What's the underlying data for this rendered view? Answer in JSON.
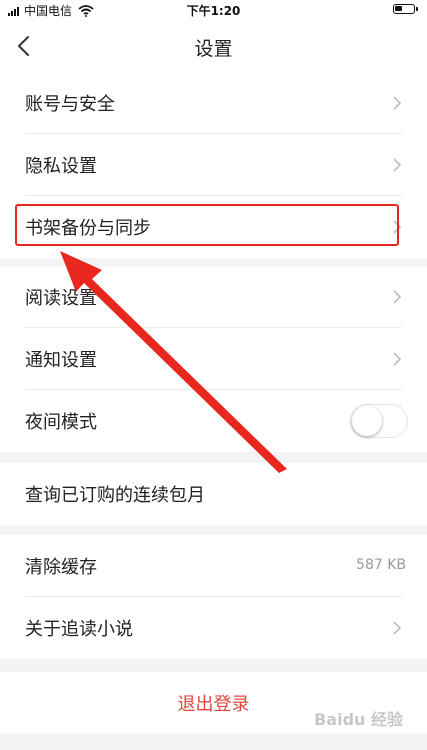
{
  "status_bar": {
    "carrier": "中国电信",
    "time": "下午1:20",
    "icons": [
      "signal-icon",
      "wifi-icon",
      "battery-icon"
    ]
  },
  "nav": {
    "back_icon": "chevron-left-icon",
    "title": "设置"
  },
  "groups": [
    {
      "items": [
        {
          "label": "账号与安全",
          "accessory": "chevron"
        },
        {
          "label": "隐私设置",
          "accessory": "chevron"
        },
        {
          "label": "书架备份与同步",
          "accessory": "chevron",
          "highlighted": true
        }
      ]
    },
    {
      "items": [
        {
          "label": "阅读设置",
          "accessory": "chevron"
        },
        {
          "label": "通知设置",
          "accessory": "chevron"
        },
        {
          "label": "夜间模式",
          "accessory": "toggle",
          "toggle_on": false
        }
      ]
    },
    {
      "items": [
        {
          "label": "查询已订购的连续包月",
          "accessory": "none"
        }
      ]
    },
    {
      "items": [
        {
          "label": "清除缓存",
          "accessory": "value",
          "value": "587 KB"
        },
        {
          "label": "关于追读小说",
          "accessory": "chevron"
        }
      ]
    }
  ],
  "logout": {
    "label": "退出登录"
  },
  "watermark": "Baidu 经验",
  "colors": {
    "annotation_red": "#e8281e",
    "logout_text": "#e0483e",
    "background": "#f4f4f4"
  }
}
